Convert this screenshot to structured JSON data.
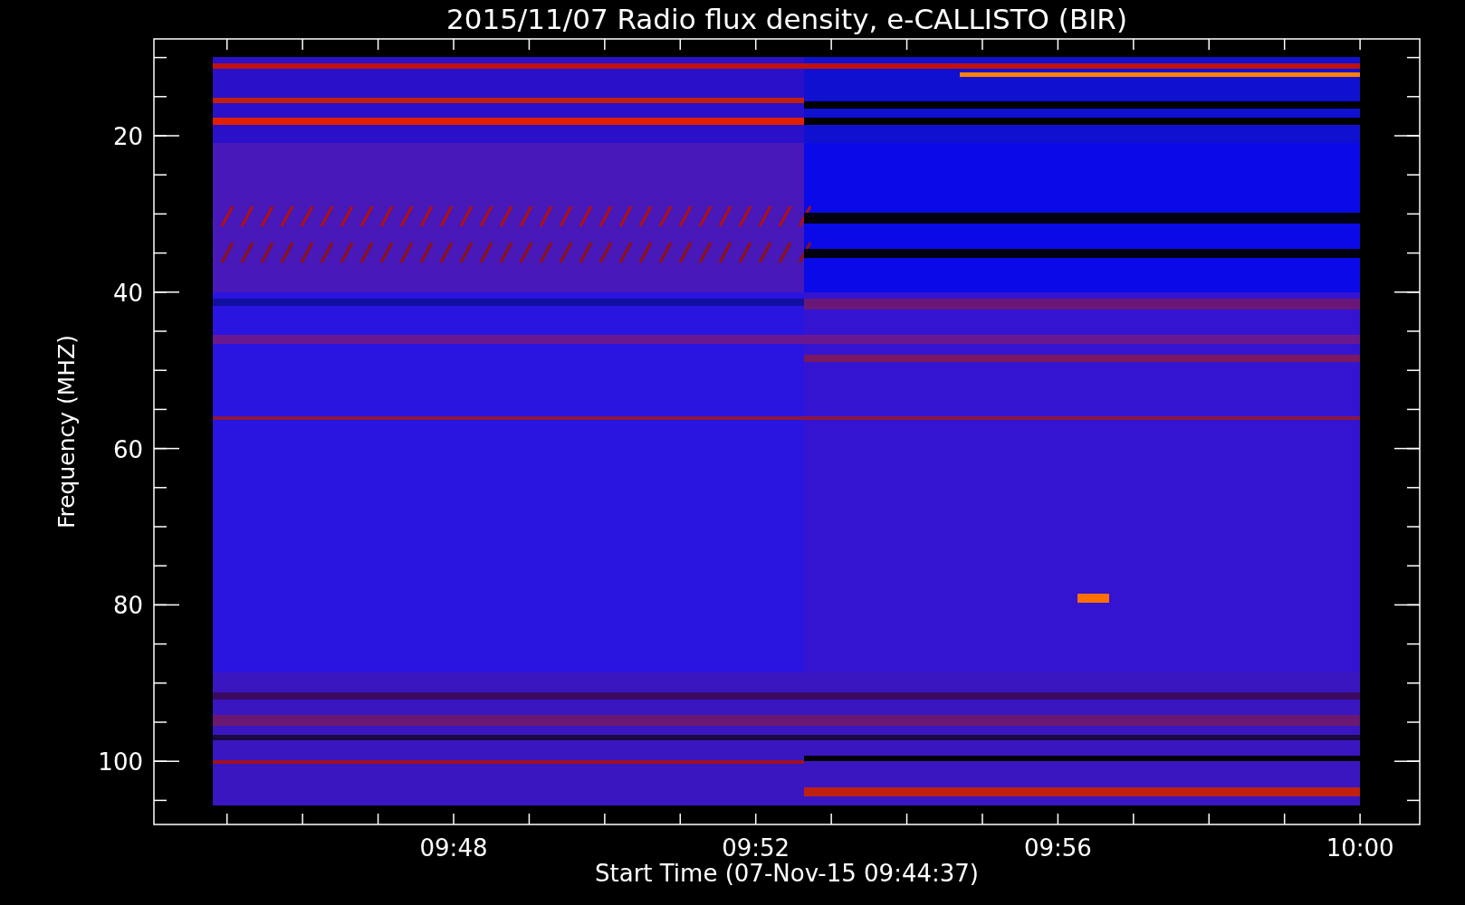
{
  "title": "2015/11/07  Radio flux density, e-CALLISTO (BIR)",
  "y_axis": {
    "label": "Frequency (MHZ)",
    "ticks": [
      "20",
      "40",
      "60",
      "80",
      "100"
    ]
  },
  "x_axis": {
    "label": "Start Time (07-Nov-15 09:44:37)",
    "ticks": [
      "09:48",
      "09:52",
      "09:56",
      "10:00"
    ]
  }
}
